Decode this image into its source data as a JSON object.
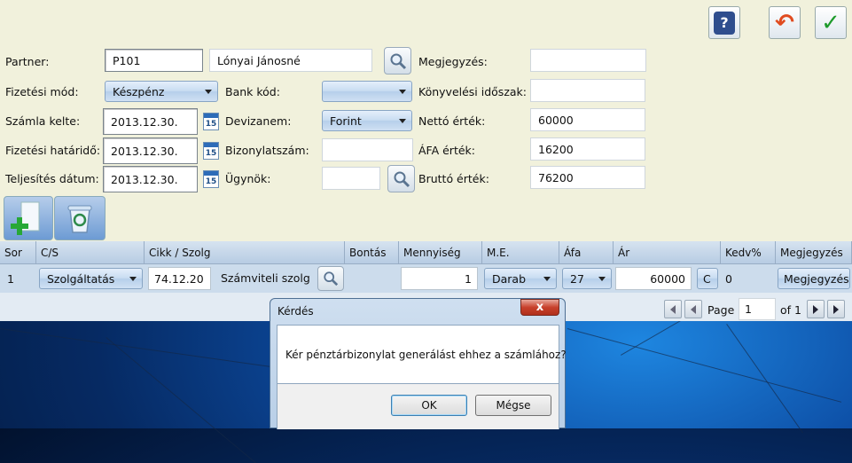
{
  "toolbar": {
    "help_label": "?",
    "back_label": "↶",
    "ok_label": "✓"
  },
  "form": {
    "partner": {
      "label": "Partner:",
      "code": "P101",
      "name": "Lónyai Jánosné"
    },
    "megjegyzes": {
      "label": "Megjegyzés:",
      "value": ""
    },
    "fizetesi_mod": {
      "label": "Fizetési mód:",
      "value": "Készpénz"
    },
    "bank_kod": {
      "label": "Bank kód:",
      "value": ""
    },
    "konyvelesi": {
      "label": "Könyvelési időszak:",
      "value": ""
    },
    "szamla_kelte": {
      "label": "Számla kelte:",
      "value": "2013.12.30."
    },
    "devizanem": {
      "label": "Devizanem:",
      "value": "Forint"
    },
    "netto": {
      "label": "Nettó érték:",
      "value": "60000"
    },
    "hatarido": {
      "label": "Fizetési határidő:",
      "value": "2013.12.30."
    },
    "bizonylatszam": {
      "label": "Bizonylatszám:",
      "value": ""
    },
    "afa_ertek": {
      "label": "ÁFA érték:",
      "value": "16200"
    },
    "teljesites": {
      "label": "Teljesítés dátum:",
      "value": "2013.12.30."
    },
    "ugynok": {
      "label": "Ügynök:",
      "value": ""
    },
    "brutto": {
      "label": "Bruttó érték:",
      "value": "76200"
    },
    "calendar_day": "15"
  },
  "grid": {
    "headers": [
      "Sor",
      "C/S",
      "Cikk / Szolg",
      "Bontás",
      "Mennyiség",
      "M.E.",
      "Áfa",
      "Ár",
      "Kedv%",
      "Megjegyzés"
    ],
    "row": {
      "sor": "1",
      "cs": "Szolgáltatás",
      "cikk_code": "74.12.20",
      "cikk_name": "Számviteli szolg",
      "mennyiseg": "1",
      "me": "Darab",
      "afa": "27",
      "ar": "60000",
      "c": "C",
      "kedv": "0",
      "megjegyzes": "Megjegyzés"
    },
    "pager": {
      "page_label": "Page",
      "page_value": "1",
      "of_label": "of 1"
    }
  },
  "dialog": {
    "title": "Kérdés",
    "close": "x",
    "message": "Kér pénztárbizonylat generálást ehhez a számlához?",
    "ok": "OK",
    "cancel": "Mégse"
  }
}
